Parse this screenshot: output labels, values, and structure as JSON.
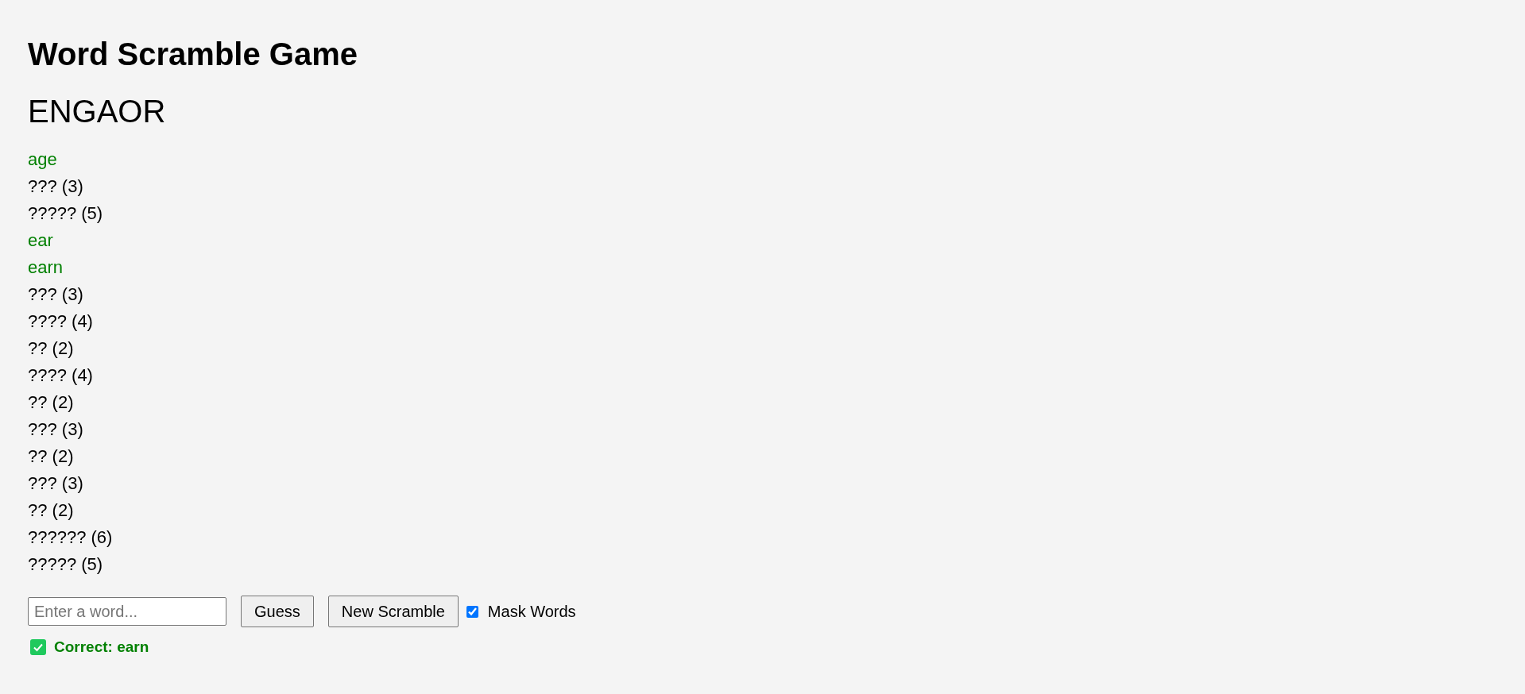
{
  "title": "Word Scramble Game",
  "scramble": "ENGAOR",
  "words": [
    {
      "text": "age",
      "found": true
    },
    {
      "text": "??? (3)",
      "found": false
    },
    {
      "text": "????? (5)",
      "found": false
    },
    {
      "text": "ear",
      "found": true
    },
    {
      "text": "earn",
      "found": true
    },
    {
      "text": "??? (3)",
      "found": false
    },
    {
      "text": "???? (4)",
      "found": false
    },
    {
      "text": "?? (2)",
      "found": false
    },
    {
      "text": "???? (4)",
      "found": false
    },
    {
      "text": "?? (2)",
      "found": false
    },
    {
      "text": "??? (3)",
      "found": false
    },
    {
      "text": "?? (2)",
      "found": false
    },
    {
      "text": "??? (3)",
      "found": false
    },
    {
      "text": "?? (2)",
      "found": false
    },
    {
      "text": "?????? (6)",
      "found": false
    },
    {
      "text": "????? (5)",
      "found": false
    }
  ],
  "guess_field": {
    "placeholder": "Enter a word..."
  },
  "buttons": [
    "Guess",
    "New Scramble"
  ],
  "mask_words": {
    "label": "Mask Words",
    "checked": true
  },
  "feedback": {
    "text": "Correct: earn",
    "kind": "correct"
  }
}
